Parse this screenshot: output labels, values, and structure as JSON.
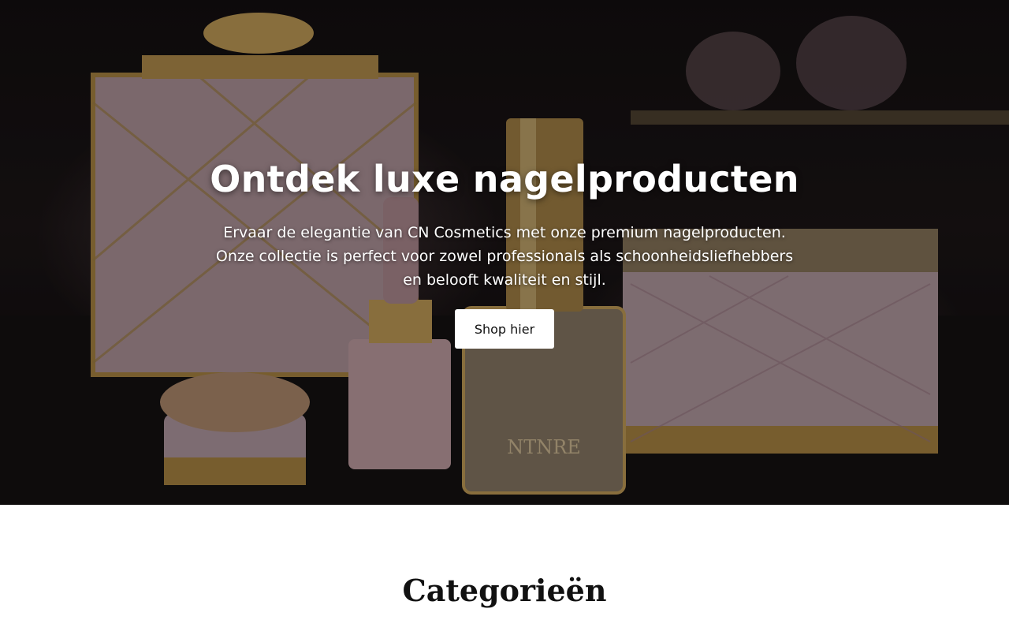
{
  "hero": {
    "title": "Ontdek luxe nagelproducten",
    "description_lines": [
      "Ervaar de elegantie van CN Cosmetics met onze premium nagelproducten.",
      "Onze collectie is perfect voor zowel professionals als schoonheidsliefhebbers",
      "en belooft kwaliteit en stijl."
    ],
    "cta_label": "Shop hier",
    "bottle_label": "NTNRE"
  },
  "categories": {
    "title": "Categorieën"
  },
  "colors": {
    "accent_gold": "#c9a25a",
    "blush_pink": "#d9b8bd",
    "button_bg": "#ffffff",
    "text_dark": "#111111"
  }
}
